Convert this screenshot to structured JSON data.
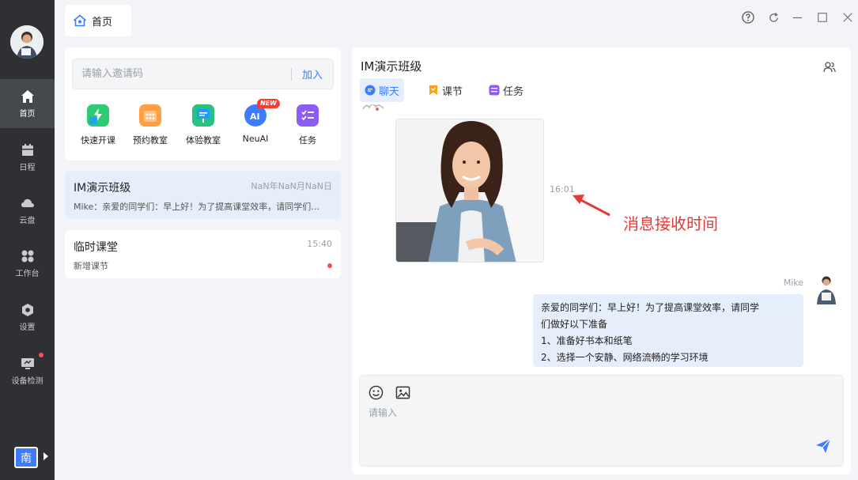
{
  "rail": {
    "items": [
      {
        "label": "首页",
        "icon": "home-icon",
        "active": true
      },
      {
        "label": "日程",
        "icon": "calendar-icon"
      },
      {
        "label": "云盘",
        "icon": "cloud-icon"
      },
      {
        "label": "工作台",
        "icon": "workbench-icon"
      },
      {
        "label": "设置",
        "icon": "settings-icon"
      },
      {
        "label": "设备检测",
        "icon": "monitor-icon"
      }
    ],
    "org_badge": "南"
  },
  "tabbar": {
    "tab_label": "首页"
  },
  "invite": {
    "placeholder": "请输入邀请码",
    "join_label": "加入"
  },
  "quick_actions": [
    {
      "label": "快速开课",
      "color": "#2ecc71"
    },
    {
      "label": "预约教室",
      "color": "#ff9f43"
    },
    {
      "label": "体验教室",
      "color": "#27c281"
    },
    {
      "label": "NeuAI",
      "color": "#3d7bff",
      "badge": "NEW"
    },
    {
      "label": "任务",
      "color": "#8c5cf5"
    }
  ],
  "conversations": [
    {
      "name": "IM演示班级",
      "time": "NaN年NaN月NaN日",
      "preview": "Mike：亲爱的同学们：早上好！为了提高课堂效率，请同学们做好以下准备",
      "active": true
    },
    {
      "name": "临时课堂",
      "time": "15:40",
      "preview": "新增课节",
      "unread": true
    }
  ],
  "chat": {
    "title": "IM演示班级",
    "tabs": [
      {
        "label": "聊天",
        "icon": "chat-icon",
        "color": "#3d7bff"
      },
      {
        "label": "课节",
        "icon": "bookmark-icon",
        "color": "#ff9f1a"
      },
      {
        "label": "任务",
        "icon": "task-icon",
        "color": "#8c5cf5"
      }
    ],
    "image_time": "16:01",
    "annotation": "消息接收时间",
    "sender_name": "Mike",
    "message_lines": [
      "亲爱的同学们：早上好！为了提高课堂效率，请同学",
      "们做好以下准备",
      "1、准备好书本和纸笔",
      "2、选择一个安静、网络流畅的学习环境"
    ],
    "composer_placeholder": "请输入"
  },
  "colors": {
    "accent": "#3d7bff",
    "annotation": "#e53935",
    "rail_bg": "#2e3033"
  }
}
